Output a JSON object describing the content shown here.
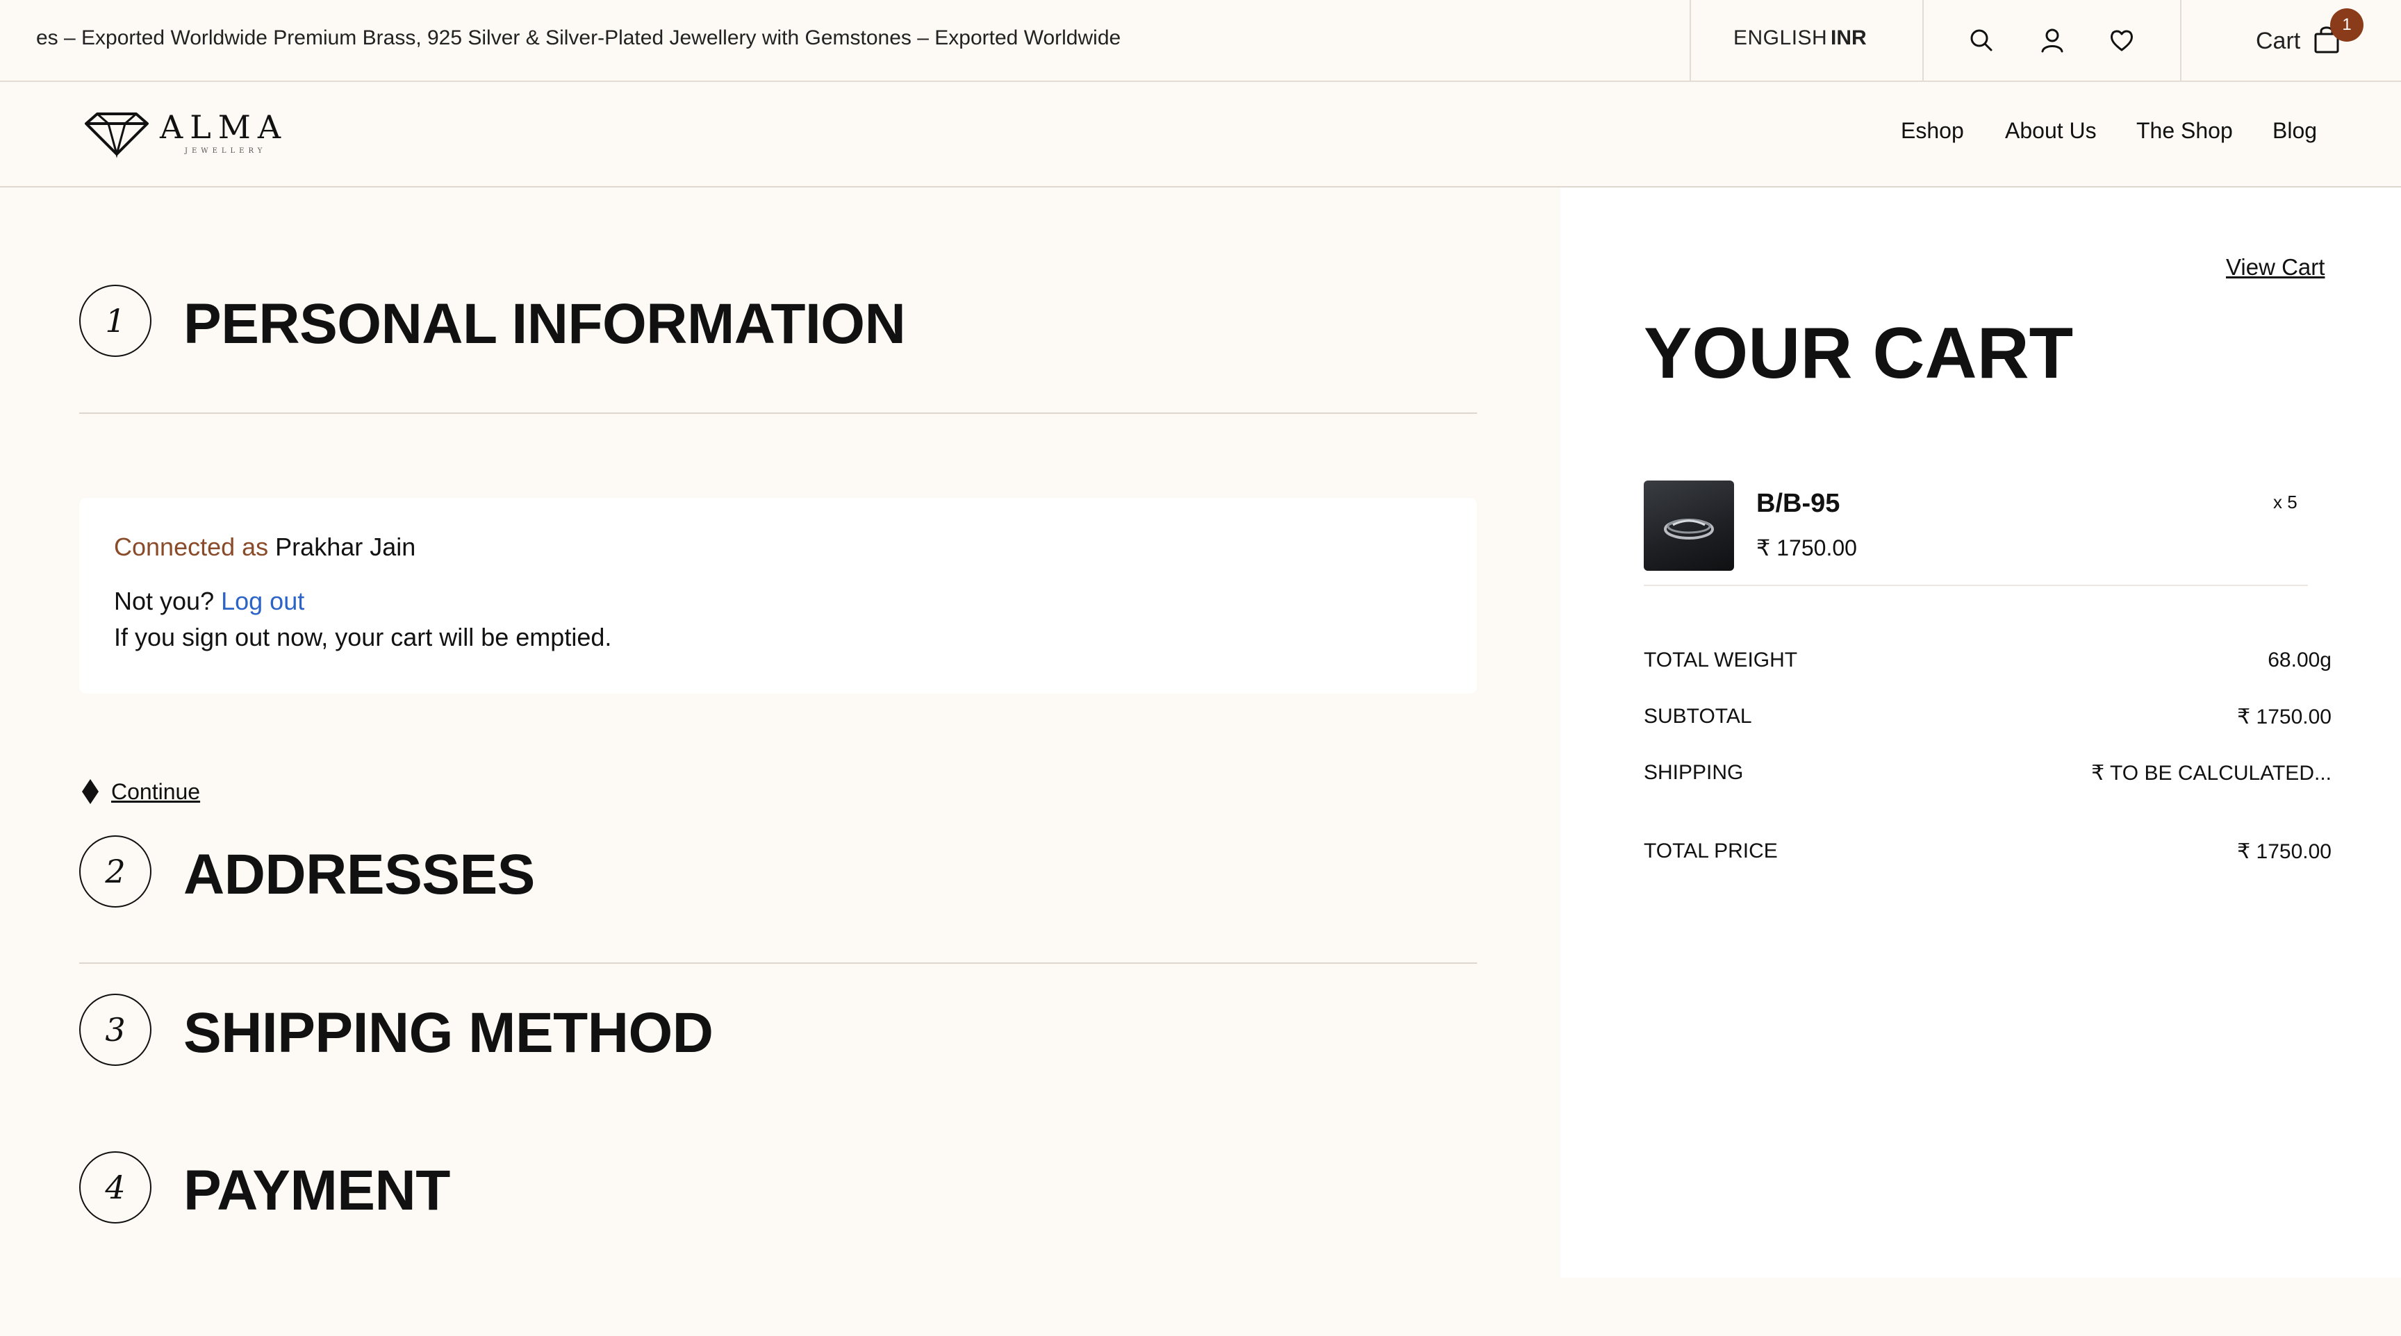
{
  "topbar": {
    "announcement": "es – Exported Worldwide Premium Brass, 925 Silver & Silver-Plated Jewellery with Gemstones – Exported Worldwide",
    "language": "ENGLISH",
    "currency": "INR",
    "cart_label": "Cart",
    "cart_count": "1",
    "icons": [
      "search-icon",
      "user-icon",
      "heart-icon",
      "shopping-bag-icon"
    ]
  },
  "header": {
    "logo_text": "ALMA",
    "logo_sub": "JEWELLERY",
    "nav": [
      "Eshop",
      "About Us",
      "The Shop",
      "Blog"
    ]
  },
  "checkout": {
    "steps": [
      {
        "number": "1",
        "title": "PERSONAL INFORMATION"
      },
      {
        "number": "2",
        "title": "ADDRESSES"
      },
      {
        "number": "3",
        "title": "SHIPPING METHOD"
      },
      {
        "number": "4",
        "title": "PAYMENT"
      }
    ],
    "connected_label": "Connected as",
    "customer_name": "Prakhar Jain",
    "not_you": "Not you?",
    "logout": "Log out",
    "warning": "If you sign out now, your cart will be emptied.",
    "continue_label": "Continue"
  },
  "cart": {
    "view_cart": "View Cart",
    "title": "YOUR CART",
    "items": [
      {
        "name": "B/B-95",
        "price": "₹ 1750.00",
        "qty": "x 5"
      }
    ],
    "summary": [
      {
        "label": "TOTAL WEIGHT",
        "value": "68.00g"
      },
      {
        "label": "SUBTOTAL",
        "value": "₹ 1750.00"
      },
      {
        "label": "SHIPPING",
        "value": "₹ TO BE CALCULATED..."
      },
      {
        "label": "TOTAL PRICE",
        "value": "₹ 1750.00"
      }
    ]
  },
  "colors": {
    "background": "#fdf9f4",
    "badge": "#8a3c1a",
    "link_blue": "#2b63c6",
    "connected_label": "#8a4b2a"
  }
}
